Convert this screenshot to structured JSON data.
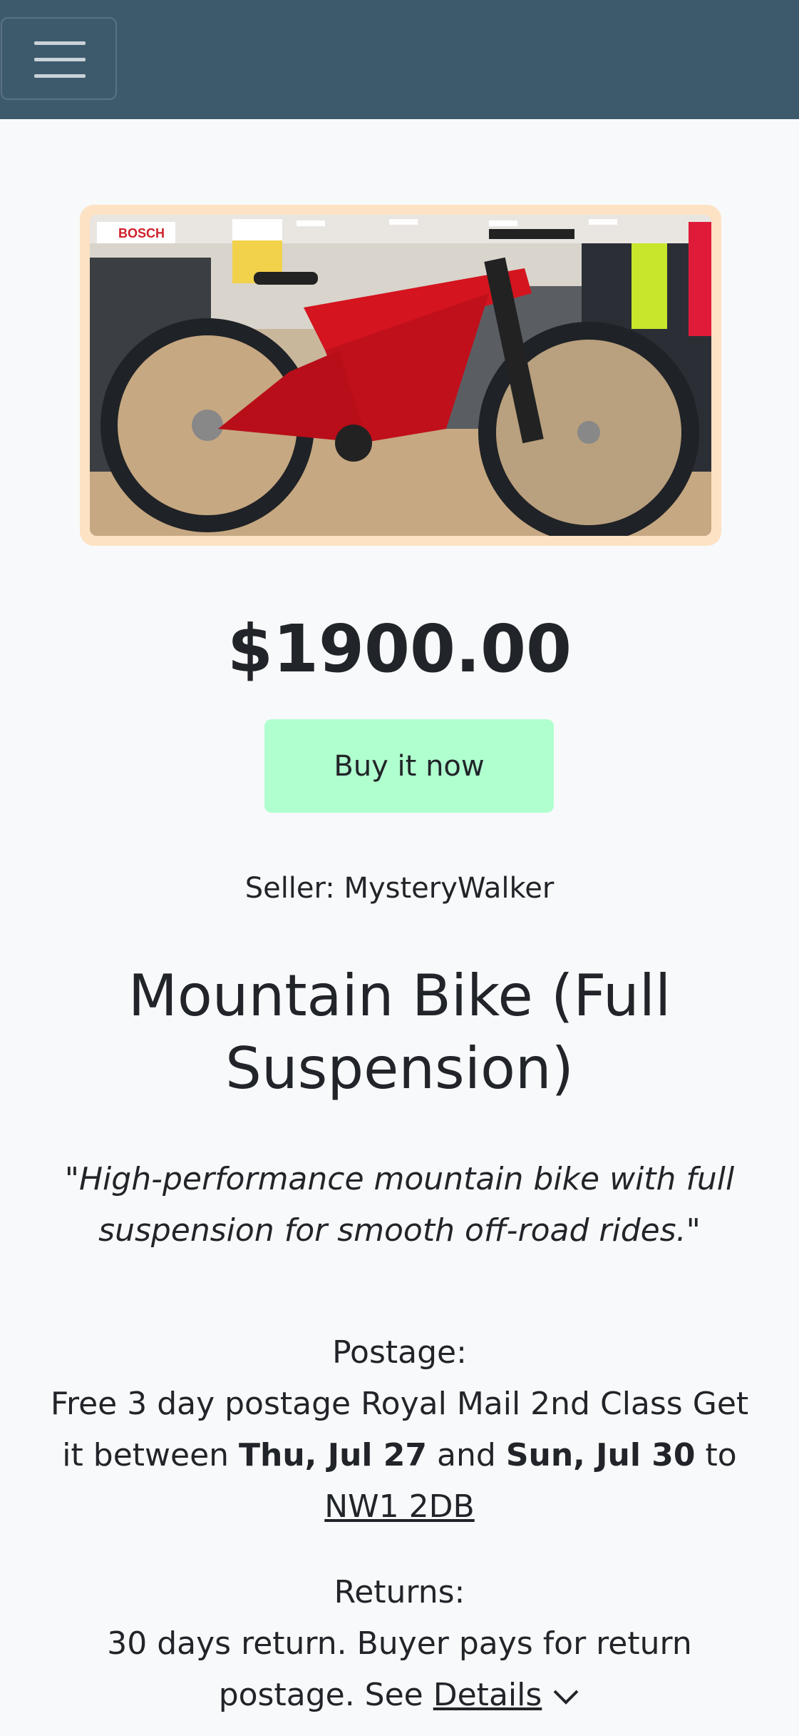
{
  "navbar": {
    "menu_icon": "hamburger-menu-icon",
    "background": "#3d5a6c"
  },
  "product": {
    "image_alt": "Red full suspension mountain bike in a bike shop",
    "image_frame_color": "#fde2c4",
    "price": "$1900.00",
    "buy_label": "Buy it now",
    "buy_color": "#b0ffcf",
    "seller_label": "Seller: MysteryWalker",
    "title": "Mountain Bike (Full Suspension)",
    "description": "\"High-performance mountain bike with full suspension for smooth off-road rides.\""
  },
  "postage": {
    "label": "Postage:",
    "text_before": "Free 3 day postage Royal Mail 2nd Class Get it between ",
    "date_from": "Thu, Jul 27",
    "text_and": " and ",
    "date_to": "Sun, Jul 30",
    "text_to": " to ",
    "postcode": "NW1 2DB"
  },
  "returns": {
    "label": "Returns:",
    "text": "30 days return. Buyer pays for return postage. See ",
    "details_link": "Details",
    "details_icon": "chevron-down-icon"
  }
}
